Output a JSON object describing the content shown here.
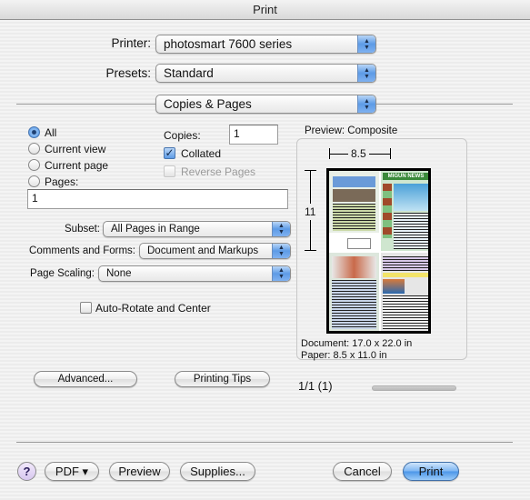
{
  "window": {
    "title": "Print"
  },
  "printer": {
    "label": "Printer:",
    "value": "photosmart 7600 series"
  },
  "presets": {
    "label": "Presets:",
    "value": "Standard"
  },
  "panel": {
    "value": "Copies & Pages"
  },
  "range": {
    "options": [
      {
        "label": "All",
        "selected": true
      },
      {
        "label": "Current view",
        "selected": false
      },
      {
        "label": "Current page",
        "selected": false
      },
      {
        "label": "Pages:",
        "selected": false
      }
    ],
    "pages_value": "1"
  },
  "copies": {
    "label": "Copies:",
    "value": "1",
    "collated": {
      "label": "Collated",
      "checked": true
    },
    "reverse": {
      "label": "Reverse Pages",
      "checked": false,
      "enabled": false
    }
  },
  "subset": {
    "label": "Subset:",
    "value": "All Pages in Range"
  },
  "comments": {
    "label": "Comments and Forms:",
    "value": "Document and Markups"
  },
  "scaling": {
    "label": "Page Scaling:",
    "value": "None"
  },
  "autorotate": {
    "label": "Auto-Rotate and Center",
    "checked": false
  },
  "preview": {
    "title": "Preview: Composite",
    "width_label": "8.5",
    "height_label": "11",
    "document": "Document: 17.0 x 22.0 in",
    "paper": "Paper: 8.5 x 11.0 in",
    "page_counter": "1/1 (1)",
    "thumbnail_headline": "MIGUN NEWS"
  },
  "buttons": {
    "advanced": "Advanced...",
    "printing_tips": "Printing Tips",
    "help": "?",
    "pdf": "PDF ▾",
    "preview": "Preview",
    "supplies": "Supplies...",
    "cancel": "Cancel",
    "print": "Print"
  },
  "icons": {
    "popup_arrows": "▲▼",
    "check": "✓"
  },
  "colors": {
    "accent": "#5d9be6",
    "default_button": "#4b95e8"
  }
}
